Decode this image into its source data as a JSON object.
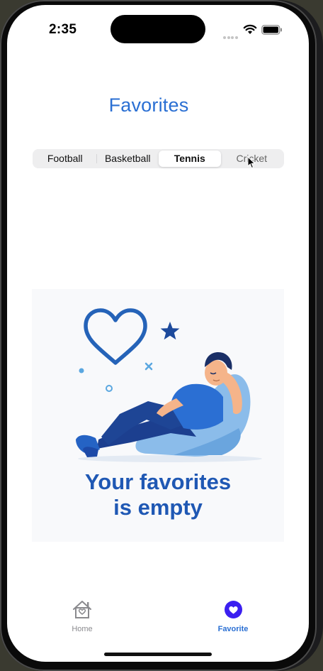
{
  "status_bar": {
    "time": "2:35"
  },
  "header": {
    "title": "Favorites"
  },
  "segments": {
    "items": [
      "Football",
      "Basketball",
      "Tennis",
      "Cricket"
    ],
    "selected": "Tennis"
  },
  "empty_state": {
    "line1": "Your favorites",
    "line2": "is empty",
    "illustration_icons": [
      "heart-outline-icon",
      "star-icon",
      "person-on-beanbag-illustration"
    ]
  },
  "tab_bar": {
    "tabs": [
      {
        "label": "Home",
        "icon": "home-icon"
      },
      {
        "label": "Favorite",
        "icon": "heart-circle-icon"
      }
    ],
    "active": "Favorite"
  },
  "colors": {
    "accent": "#2a6fd3",
    "empty_text": "#1f58b4",
    "segment_bg": "#eeeeef"
  }
}
